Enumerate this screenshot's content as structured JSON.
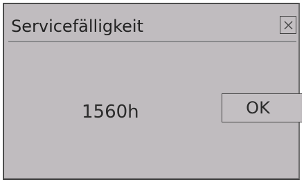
{
  "dialog": {
    "title": "Servicefälligkeit",
    "message_value": "1560h",
    "ok_label": "OK",
    "close_icon": "close-icon"
  },
  "colors": {
    "dialog_background": "#c0bcbf",
    "border": "#4d4d4d",
    "divider": "#8a8a8c",
    "text": "#222222"
  }
}
